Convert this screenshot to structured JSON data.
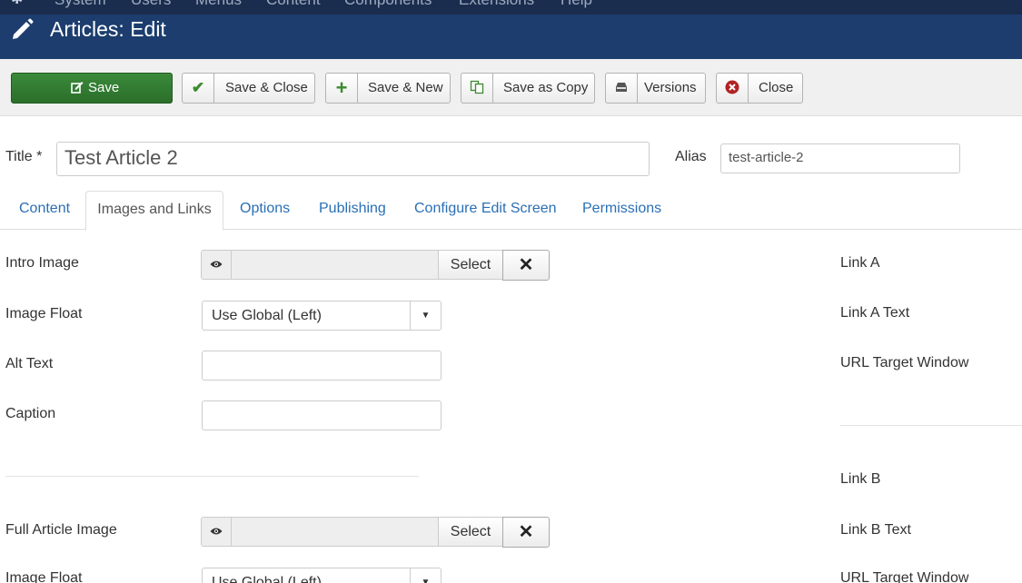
{
  "topmenu": {
    "items": [
      "System",
      "Users",
      "Menus",
      "Content",
      "Components",
      "Extensions",
      "Help"
    ]
  },
  "header": {
    "title": "Articles: Edit",
    "icon": "pencil-icon",
    "background": "#1c3d6e"
  },
  "toolbar": {
    "save": "Save",
    "save_close": "Save & Close",
    "save_new": "Save & New",
    "save_copy": "Save as Copy",
    "versions": "Versions",
    "close": "Close",
    "save_color": "#2f7d2f"
  },
  "form": {
    "title_label": "Title *",
    "title_value": "Test Article 2",
    "alias_label": "Alias",
    "alias_value": "test-article-2"
  },
  "tabs": [
    "Content",
    "Images and Links",
    "Options",
    "Publishing",
    "Configure Edit Screen",
    "Permissions"
  ],
  "active_tab": "Images and Links",
  "images": {
    "intro_image": "Intro Image",
    "image_float": "Image Float",
    "float_value": "Use Global (Left)",
    "alt_text": "Alt Text",
    "caption": "Caption",
    "full_image": "Full Article Image",
    "image_float_2": "Image Float",
    "float_value_2": "Use Global (Left)",
    "select": "Select"
  },
  "links": {
    "link_a": "Link A",
    "link_a_text": "Link A Text",
    "url_target_a": "URL Target Window",
    "link_b": "Link B",
    "link_b_text": "Link B Text",
    "url_target_b": "URL Target Window"
  }
}
